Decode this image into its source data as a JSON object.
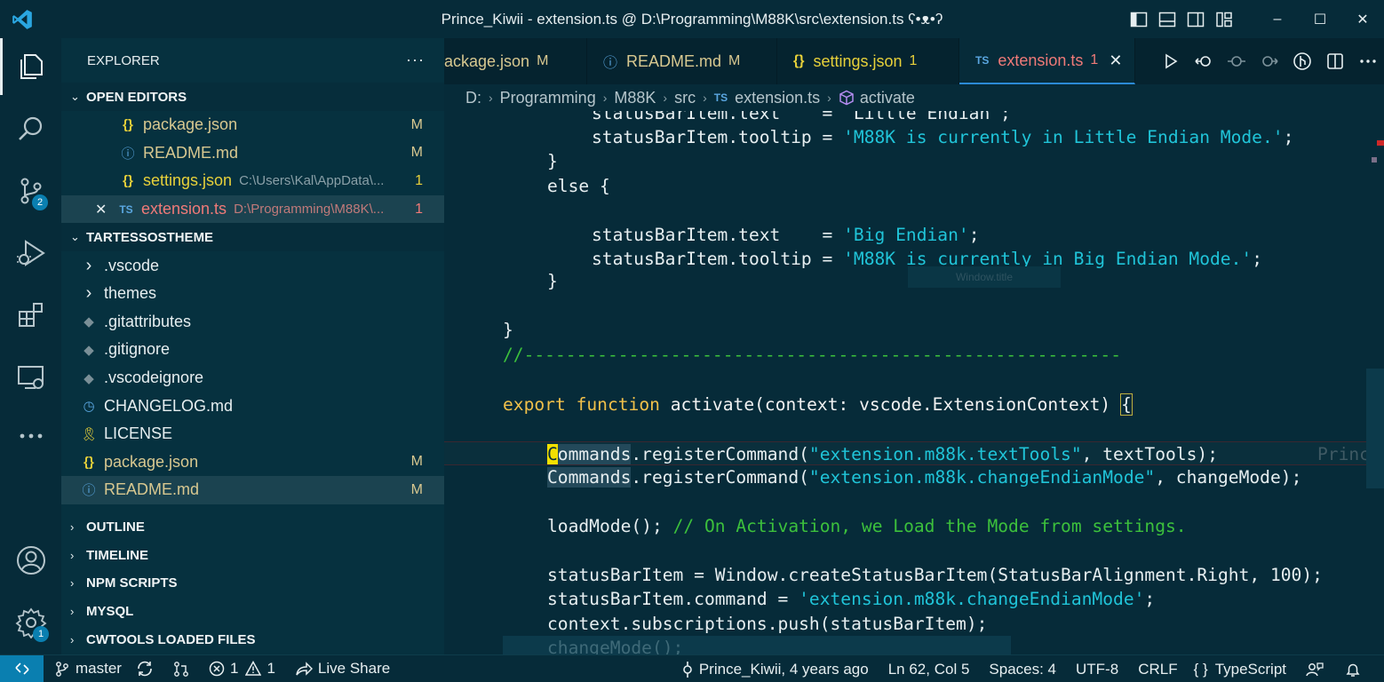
{
  "window": {
    "title": "Prince_Kiwii - extension.ts @ D:\\Programming\\M88K\\src\\extension.ts ʕ•ᴥ•ʔ",
    "minimize": "–",
    "maximize": "☐",
    "close": "✕"
  },
  "activity": {
    "scm_badge": "2",
    "settings_badge": "1"
  },
  "sidebar": {
    "title": "EXPLORER",
    "more": "···",
    "open_editors": {
      "label": "OPEN EDITORS",
      "items": [
        {
          "icon": "{}",
          "name": "package.json",
          "desc": "",
          "mark": "M"
        },
        {
          "icon": "ⓘ",
          "name": "README.md",
          "desc": "",
          "mark": "M"
        },
        {
          "icon": "{}",
          "name": "settings.json",
          "desc": "C:\\Users\\Kal\\AppData\\...",
          "mark": "1"
        },
        {
          "icon": "TS",
          "name": "extension.ts",
          "desc": "D:\\Programming\\M88K\\...",
          "mark": "1",
          "close": "✕"
        }
      ]
    },
    "workspace": {
      "label": "TARTESSOSTHEME",
      "items": [
        {
          "icon": "›",
          "name": ".vscode",
          "mark": ""
        },
        {
          "icon": "›",
          "name": "themes",
          "mark": ""
        },
        {
          "icon": "◆",
          "name": ".gitattributes",
          "mark": ""
        },
        {
          "icon": "◆",
          "name": ".gitignore",
          "mark": ""
        },
        {
          "icon": "◆",
          "name": ".vscodeignore",
          "mark": ""
        },
        {
          "icon": "◷",
          "name": "CHANGELOG.md",
          "mark": ""
        },
        {
          "icon": "🎗",
          "name": "LICENSE",
          "mark": ""
        },
        {
          "icon": "{}",
          "name": "package.json",
          "mark": "M"
        },
        {
          "icon": "ⓘ",
          "name": "README.md",
          "mark": "M"
        }
      ]
    },
    "collapsed_sections": [
      "OUTLINE",
      "TIMELINE",
      "NPM SCRIPTS",
      "MYSQL",
      "CWTOOLS LOADED FILES"
    ]
  },
  "tabs": [
    {
      "icon": "",
      "label": "ackage.json",
      "mark": "M"
    },
    {
      "icon": "ⓘ",
      "label": "README.md",
      "mark": "M"
    },
    {
      "icon": "{}",
      "label": "settings.json",
      "mark": "1"
    },
    {
      "icon": "TS",
      "label": "extension.ts",
      "mark": "1",
      "close": "✕"
    }
  ],
  "breadcrumb": {
    "parts": [
      "D:",
      "Programming",
      "M88K",
      "src"
    ],
    "file_icon": "TS",
    "file": "extension.ts",
    "symbol": "activate",
    "sep": "›"
  },
  "editor": {
    "lines": {
      "l0": "statusBarItem.text    = 'Little Endian';",
      "l1a": "statusBarItem.tooltip = ",
      "l1b": "'M88K is currently in Little Endian Mode.'",
      "l1c": ";",
      "l2": "}",
      "l3": "else {",
      "l4a": "statusBarItem.text    = ",
      "l4b": "'Big Endian'",
      "l4c": ";",
      "l5a": "statusBarItem.tooltip = ",
      "l5b": "'M88K is currently in Big Endian Mode.'",
      "l5c": ";",
      "l6": "}",
      "l7": "}",
      "l8": "//---------------------------------------------------------",
      "l9a": "export",
      "l9b": "function",
      "l9c": "activate(context: vscode.ExtensionContext) ",
      "l9d": "{",
      "l10a": "C",
      "l10b": "ommands",
      "l10c": ".registerCommand(",
      "l10d": "\"extension.m88k.textTools\"",
      "l10e": ", textTools);",
      "l10f": "Princ",
      "l11a": "Commands",
      "l11b": ".registerCommand(",
      "l11c": "\"extension.m88k.changeEndianMode\"",
      "l11d": ", changeMode);",
      "l12a": "loadMode(); ",
      "l12b": "// On Activation, we Load the Mode from settings.",
      "l13": "statusBarItem = Window.createStatusBarItem(StatusBarAlignment.Right, 100);",
      "l14a": "statusBarItem.command = ",
      "l14b": "'extension.m88k.changeEndianMode'",
      "l14c": ";",
      "l15": "context.subscriptions.push(statusBarItem);",
      "l16": "changeMode();"
    },
    "widget_text": "Window.title"
  },
  "status": {
    "branch": "master",
    "errors": "1",
    "warnings": "1",
    "live_share": "Live Share",
    "blame": "Prince_Kiwii, 4 years ago",
    "position": "Ln 62, Col 5",
    "spaces": "Spaces: 4",
    "encoding": "UTF-8",
    "eol": "CRLF",
    "lang_icon": "{ }",
    "language": "TypeScript"
  },
  "colors": {
    "background": "#062b39",
    "string": "#20c4d8",
    "keyword": "#f0c04a",
    "comment": "#3cc03c",
    "error": "#f07a78",
    "modified": "#d8c890",
    "accent": "#0a7fb0"
  }
}
